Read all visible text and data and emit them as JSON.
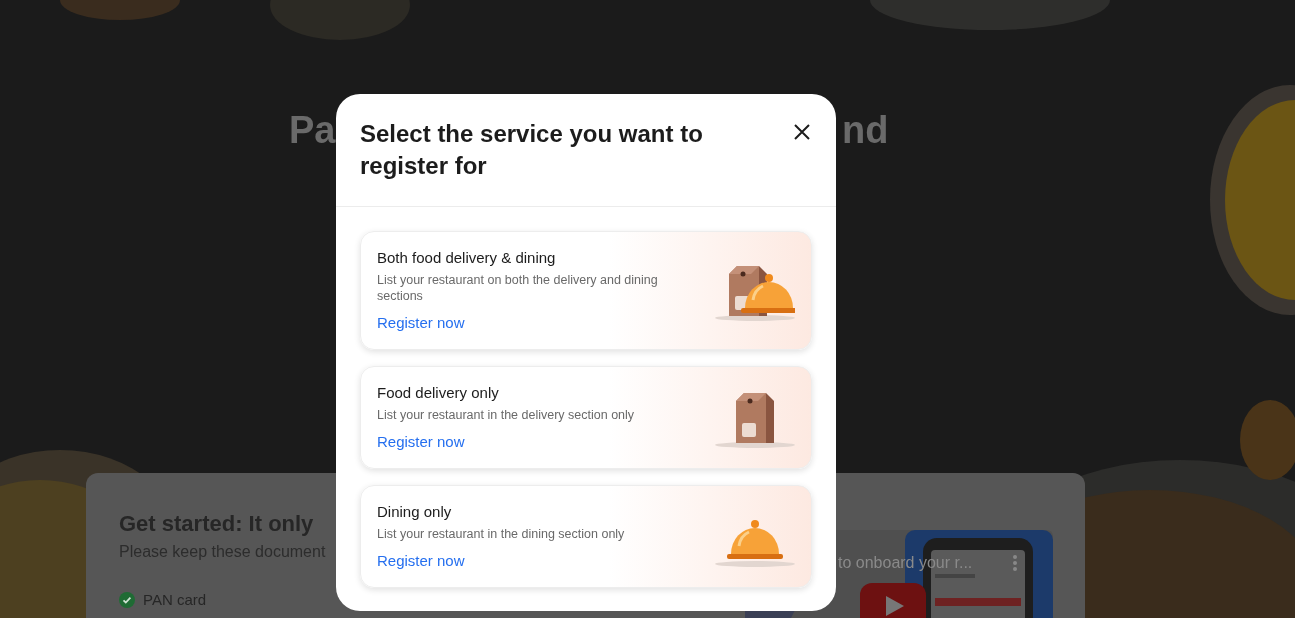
{
  "background": {
    "heading_fragments": [
      "Pa",
      "nd"
    ],
    "get_started": {
      "title": "Get started: It only",
      "subtitle": "Please keep these document",
      "documents": [
        {
          "label": "PAN card",
          "checked": true
        }
      ]
    },
    "video": {
      "title": "to onboard your r..."
    }
  },
  "modal": {
    "title": "Select the service you want to register for",
    "services": [
      {
        "kind": "both",
        "title": "Both food delivery & dining",
        "description": "List your restaurant on both the delivery and dining sections",
        "link": "Register now"
      },
      {
        "kind": "delivery",
        "title": "Food delivery only",
        "description": "List your restaurant in the delivery section only",
        "link": "Register now"
      },
      {
        "kind": "dining",
        "title": "Dining only",
        "description": "List your restaurant in the dining section only",
        "link": "Register now"
      }
    ]
  }
}
